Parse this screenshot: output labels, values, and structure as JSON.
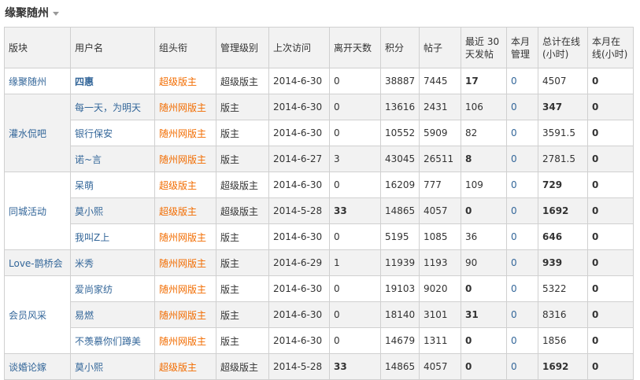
{
  "page": {
    "title": "缘聚随州"
  },
  "columns": [
    "版块",
    "用户名",
    "组头衔",
    "管理级别",
    "上次访问",
    "离开天数",
    "积分",
    "帖子",
    "最近 30 天发帖",
    "本月管理",
    "总计在线(小时)",
    "本月在线(小时)"
  ],
  "groups": [
    {
      "board": "缘聚随州",
      "rows": [
        {
          "user": "四惠",
          "user_bold": true,
          "title": "超级版主",
          "level": "超级版主",
          "last": "2014-6-30",
          "days": "0",
          "points": "38887",
          "posts": "7445",
          "recent": "17",
          "recent_bold": true,
          "month_mgmt": "0",
          "online": "4507",
          "online_bold": false,
          "month_online": "0"
        }
      ]
    },
    {
      "board": "灌水侃吧",
      "rows": [
        {
          "user": "每一天，为明天",
          "title": "随州网版主",
          "level": "版主",
          "last": "2014-6-30",
          "days": "0",
          "points": "13616",
          "posts": "2431",
          "recent": "106",
          "recent_bold": false,
          "month_mgmt": "0",
          "online": "347",
          "online_bold": true,
          "month_online": "0"
        },
        {
          "user": "银行保安",
          "title": "随州网版主",
          "level": "版主",
          "last": "2014-6-30",
          "days": "0",
          "points": "10552",
          "posts": "5909",
          "recent": "82",
          "recent_bold": false,
          "month_mgmt": "0",
          "online": "3591.5",
          "online_bold": false,
          "month_online": "0"
        },
        {
          "user": "诺~言",
          "title": "随州网版主",
          "level": "版主",
          "last": "2014-6-27",
          "days": "3",
          "points": "43045",
          "posts": "26511",
          "recent": "8",
          "recent_bold": true,
          "month_mgmt": "0",
          "online": "2781.5",
          "online_bold": false,
          "month_online": "0"
        }
      ]
    },
    {
      "board": "同城活动",
      "rows": [
        {
          "user": "呆萌",
          "title": "超级版主",
          "level": "超级版主",
          "last": "2014-6-30",
          "days": "0",
          "points": "16209",
          "posts": "777",
          "recent": "109",
          "recent_bold": false,
          "month_mgmt": "0",
          "online": "729",
          "online_bold": true,
          "month_online": "0"
        },
        {
          "user": "莫小熙",
          "title": "超级版主",
          "level": "超级版主",
          "last": "2014-5-28",
          "days": "33",
          "days_bold": true,
          "points": "14865",
          "posts": "4057",
          "recent": "0",
          "recent_bold": true,
          "month_mgmt": "0",
          "online": "1692",
          "online_bold": true,
          "month_online": "0"
        },
        {
          "user": "我叫Z上",
          "title": "随州网版主",
          "level": "版主",
          "last": "2014-6-30",
          "days": "0",
          "points": "5195",
          "posts": "1085",
          "recent": "36",
          "recent_bold": false,
          "month_mgmt": "0",
          "online": "646",
          "online_bold": true,
          "month_online": "0"
        }
      ]
    },
    {
      "board": "Love-鹊桥会",
      "rows": [
        {
          "user": "米秀",
          "title": "随州网版主",
          "level": "版主",
          "last": "2014-6-29",
          "days": "1",
          "points": "11939",
          "posts": "1193",
          "recent": "90",
          "recent_bold": false,
          "month_mgmt": "0",
          "online": "939",
          "online_bold": true,
          "month_online": "0"
        }
      ]
    },
    {
      "board": "会员风采",
      "rows": [
        {
          "user": "爱尚家纺",
          "title": "随州网版主",
          "level": "版主",
          "last": "2014-6-30",
          "days": "0",
          "points": "19103",
          "posts": "9020",
          "recent": "0",
          "recent_bold": true,
          "month_mgmt": "0",
          "online": "5322",
          "online_bold": false,
          "month_online": "0"
        },
        {
          "user": "易燃",
          "title": "随州网版主",
          "level": "版主",
          "last": "2014-6-30",
          "days": "0",
          "points": "18140",
          "posts": "3101",
          "recent": "31",
          "recent_bold": true,
          "month_mgmt": "0",
          "online": "8316",
          "online_bold": false,
          "month_online": "0"
        },
        {
          "user": "不羡慕你们蹲美",
          "title": "随州网版主",
          "level": "版主",
          "last": "2014-6-30",
          "days": "0",
          "points": "14679",
          "posts": "1311",
          "recent": "0",
          "recent_bold": true,
          "month_mgmt": "0",
          "online": "1856",
          "online_bold": false,
          "month_online": "0"
        }
      ]
    },
    {
      "board": "谈婚论嫁",
      "rows": [
        {
          "user": "莫小熙",
          "title": "超级版主",
          "level": "超级版主",
          "last": "2014-5-28",
          "days": "33",
          "days_bold": true,
          "points": "14865",
          "posts": "4057",
          "recent": "0",
          "recent_bold": true,
          "month_mgmt": "0",
          "online": "1692",
          "online_bold": true,
          "month_online": "0"
        }
      ]
    }
  ],
  "colors": {
    "link": "#336699",
    "title_tag": "#f26c00",
    "alt_row": "#f2f2f2",
    "border": "#d0d0d0"
  }
}
